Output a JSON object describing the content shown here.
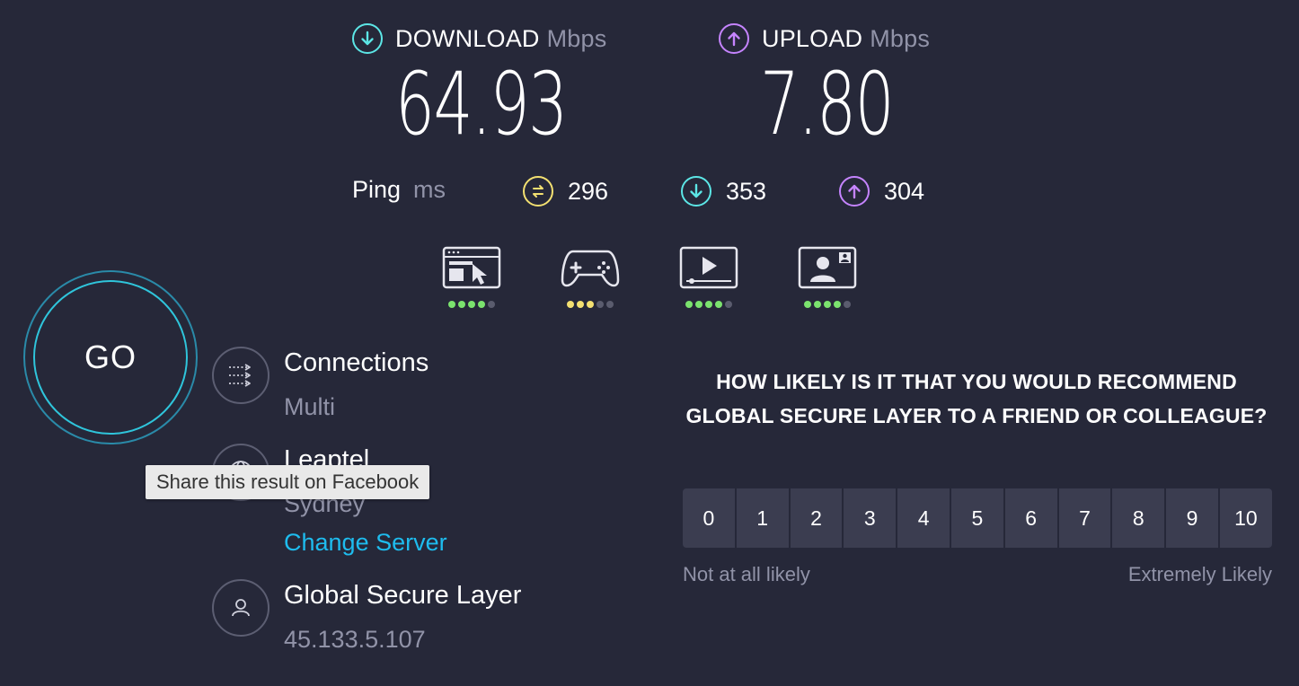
{
  "download": {
    "title": "DOWNLOAD",
    "unit": "Mbps",
    "value": "64.93",
    "color": "#5ce6e6"
  },
  "upload": {
    "title": "UPLOAD",
    "unit": "Mbps",
    "value": "7.80",
    "color": "#c584ff"
  },
  "ping": {
    "label": "Ping",
    "unit": "ms",
    "idle": "296",
    "download": "353",
    "upload": "304",
    "idle_color": "#f3e071"
  },
  "activities": [
    {
      "icon": "web-browsing-icon",
      "rating": 4,
      "max": 5,
      "color": "#7be36e"
    },
    {
      "icon": "gaming-icon",
      "rating": 3,
      "max": 5,
      "color": "#f3e071"
    },
    {
      "icon": "streaming-icon",
      "rating": 4,
      "max": 5,
      "color": "#7be36e"
    },
    {
      "icon": "video-call-icon",
      "rating": 4,
      "max": 5,
      "color": "#7be36e"
    }
  ],
  "go_button": {
    "label": "GO"
  },
  "connections": {
    "title": "Connections",
    "value": "Multi"
  },
  "server": {
    "name": "Leaptel",
    "location": "Sydney",
    "change_label": "Change Server"
  },
  "provider": {
    "name": "Global Secure Layer",
    "ip": "45.133.5.107"
  },
  "tooltip": {
    "text": "Share this result on Facebook"
  },
  "survey": {
    "question": "HOW LIKELY IS IT THAT YOU WOULD RECOMMEND GLOBAL SECURE LAYER TO A FRIEND OR COLLEAGUE?",
    "options": [
      "0",
      "1",
      "2",
      "3",
      "4",
      "5",
      "6",
      "7",
      "8",
      "9",
      "10"
    ],
    "low_label": "Not at all likely",
    "high_label": "Extremely Likely"
  }
}
